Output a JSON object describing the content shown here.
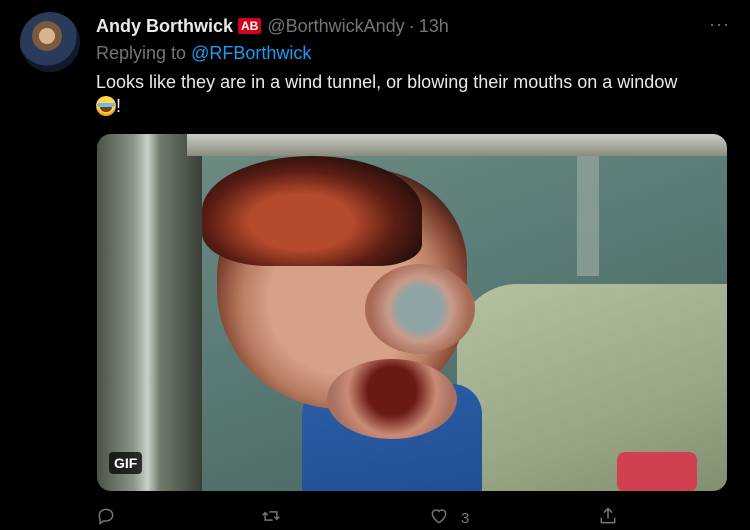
{
  "tweet": {
    "display_name": "Andy Borthwick",
    "badge": "AB",
    "handle": "@BorthwickAndy",
    "separator": "·",
    "time": "13h",
    "more": "···",
    "replying_prefix": "Replying to",
    "replying_to": "@RFBorthwick",
    "text": "Looks like they are in a wind tunnel, or blowing their mouths on a window",
    "text_suffix": "!",
    "emoji_icon": "face-with-tears-of-joy-icon",
    "media": {
      "badge": "GIF"
    },
    "actions": {
      "reply_count": "",
      "retweet_count": "",
      "like_count": "3",
      "share_count": ""
    }
  },
  "colors": {
    "background": "#000000",
    "text": "#e7e9ea",
    "muted": "#71767b",
    "link": "#1d9bf0",
    "badge": "#d0021b"
  }
}
